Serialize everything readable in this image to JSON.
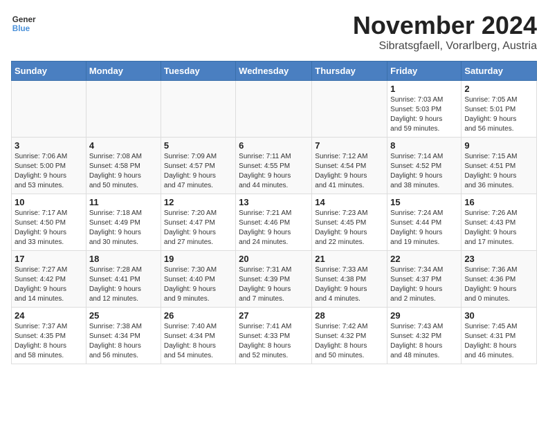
{
  "logo": {
    "line1": "General",
    "line2": "Blue"
  },
  "title": "November 2024",
  "location": "Sibratsgfaell, Vorarlberg, Austria",
  "weekdays": [
    "Sunday",
    "Monday",
    "Tuesday",
    "Wednesday",
    "Thursday",
    "Friday",
    "Saturday"
  ],
  "weeks": [
    [
      {
        "day": "",
        "info": ""
      },
      {
        "day": "",
        "info": ""
      },
      {
        "day": "",
        "info": ""
      },
      {
        "day": "",
        "info": ""
      },
      {
        "day": "",
        "info": ""
      },
      {
        "day": "1",
        "info": "Sunrise: 7:03 AM\nSunset: 5:03 PM\nDaylight: 9 hours\nand 59 minutes."
      },
      {
        "day": "2",
        "info": "Sunrise: 7:05 AM\nSunset: 5:01 PM\nDaylight: 9 hours\nand 56 minutes."
      }
    ],
    [
      {
        "day": "3",
        "info": "Sunrise: 7:06 AM\nSunset: 5:00 PM\nDaylight: 9 hours\nand 53 minutes."
      },
      {
        "day": "4",
        "info": "Sunrise: 7:08 AM\nSunset: 4:58 PM\nDaylight: 9 hours\nand 50 minutes."
      },
      {
        "day": "5",
        "info": "Sunrise: 7:09 AM\nSunset: 4:57 PM\nDaylight: 9 hours\nand 47 minutes."
      },
      {
        "day": "6",
        "info": "Sunrise: 7:11 AM\nSunset: 4:55 PM\nDaylight: 9 hours\nand 44 minutes."
      },
      {
        "day": "7",
        "info": "Sunrise: 7:12 AM\nSunset: 4:54 PM\nDaylight: 9 hours\nand 41 minutes."
      },
      {
        "day": "8",
        "info": "Sunrise: 7:14 AM\nSunset: 4:52 PM\nDaylight: 9 hours\nand 38 minutes."
      },
      {
        "day": "9",
        "info": "Sunrise: 7:15 AM\nSunset: 4:51 PM\nDaylight: 9 hours\nand 36 minutes."
      }
    ],
    [
      {
        "day": "10",
        "info": "Sunrise: 7:17 AM\nSunset: 4:50 PM\nDaylight: 9 hours\nand 33 minutes."
      },
      {
        "day": "11",
        "info": "Sunrise: 7:18 AM\nSunset: 4:49 PM\nDaylight: 9 hours\nand 30 minutes."
      },
      {
        "day": "12",
        "info": "Sunrise: 7:20 AM\nSunset: 4:47 PM\nDaylight: 9 hours\nand 27 minutes."
      },
      {
        "day": "13",
        "info": "Sunrise: 7:21 AM\nSunset: 4:46 PM\nDaylight: 9 hours\nand 24 minutes."
      },
      {
        "day": "14",
        "info": "Sunrise: 7:23 AM\nSunset: 4:45 PM\nDaylight: 9 hours\nand 22 minutes."
      },
      {
        "day": "15",
        "info": "Sunrise: 7:24 AM\nSunset: 4:44 PM\nDaylight: 9 hours\nand 19 minutes."
      },
      {
        "day": "16",
        "info": "Sunrise: 7:26 AM\nSunset: 4:43 PM\nDaylight: 9 hours\nand 17 minutes."
      }
    ],
    [
      {
        "day": "17",
        "info": "Sunrise: 7:27 AM\nSunset: 4:42 PM\nDaylight: 9 hours\nand 14 minutes."
      },
      {
        "day": "18",
        "info": "Sunrise: 7:28 AM\nSunset: 4:41 PM\nDaylight: 9 hours\nand 12 minutes."
      },
      {
        "day": "19",
        "info": "Sunrise: 7:30 AM\nSunset: 4:40 PM\nDaylight: 9 hours\nand 9 minutes."
      },
      {
        "day": "20",
        "info": "Sunrise: 7:31 AM\nSunset: 4:39 PM\nDaylight: 9 hours\nand 7 minutes."
      },
      {
        "day": "21",
        "info": "Sunrise: 7:33 AM\nSunset: 4:38 PM\nDaylight: 9 hours\nand 4 minutes."
      },
      {
        "day": "22",
        "info": "Sunrise: 7:34 AM\nSunset: 4:37 PM\nDaylight: 9 hours\nand 2 minutes."
      },
      {
        "day": "23",
        "info": "Sunrise: 7:36 AM\nSunset: 4:36 PM\nDaylight: 9 hours\nand 0 minutes."
      }
    ],
    [
      {
        "day": "24",
        "info": "Sunrise: 7:37 AM\nSunset: 4:35 PM\nDaylight: 8 hours\nand 58 minutes."
      },
      {
        "day": "25",
        "info": "Sunrise: 7:38 AM\nSunset: 4:34 PM\nDaylight: 8 hours\nand 56 minutes."
      },
      {
        "day": "26",
        "info": "Sunrise: 7:40 AM\nSunset: 4:34 PM\nDaylight: 8 hours\nand 54 minutes."
      },
      {
        "day": "27",
        "info": "Sunrise: 7:41 AM\nSunset: 4:33 PM\nDaylight: 8 hours\nand 52 minutes."
      },
      {
        "day": "28",
        "info": "Sunrise: 7:42 AM\nSunset: 4:32 PM\nDaylight: 8 hours\nand 50 minutes."
      },
      {
        "day": "29",
        "info": "Sunrise: 7:43 AM\nSunset: 4:32 PM\nDaylight: 8 hours\nand 48 minutes."
      },
      {
        "day": "30",
        "info": "Sunrise: 7:45 AM\nSunset: 4:31 PM\nDaylight: 8 hours\nand 46 minutes."
      }
    ]
  ]
}
